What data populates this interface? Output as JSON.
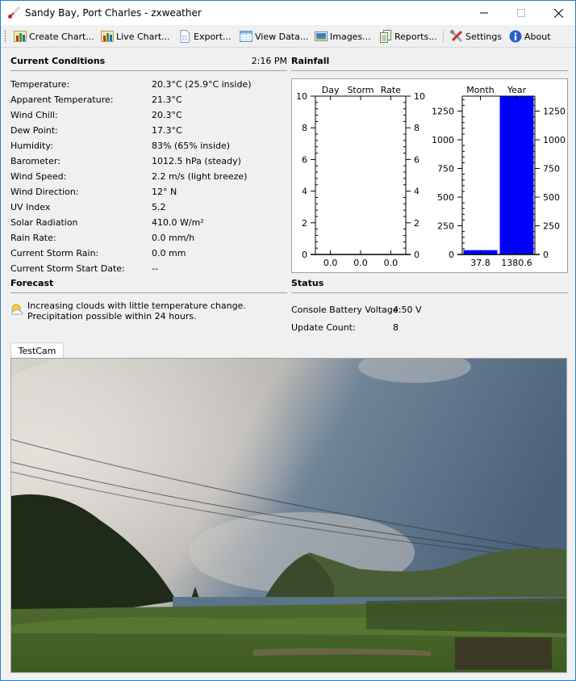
{
  "window": {
    "title": "Sandy Bay, Port Charles - zxweather",
    "icon": "thermometer-icon",
    "controls": {
      "minimize": "minimize-icon",
      "maximize": "maximize-icon",
      "close": "close-icon"
    }
  },
  "toolbar": {
    "items": [
      {
        "label": "Create Chart...",
        "icon": "bar-chart-icon"
      },
      {
        "label": "Live Chart...",
        "icon": "bar-chart-icon"
      },
      {
        "label": "Export...",
        "icon": "document-export-icon"
      },
      {
        "label": "View Data...",
        "icon": "table-icon"
      },
      {
        "label": "Images...",
        "icon": "image-icon"
      },
      {
        "label": "Reports...",
        "icon": "reports-icon"
      },
      {
        "label": "Settings",
        "icon": "tools-icon"
      },
      {
        "label": "About",
        "icon": "info-icon"
      }
    ]
  },
  "current_conditions": {
    "title": "Current Conditions",
    "time": "2:16 PM",
    "rows": [
      {
        "label": "Temperature:",
        "value": "20.3°C (25.9°C inside)"
      },
      {
        "label": "Apparent Temperature:",
        "value": "21.3°C"
      },
      {
        "label": "Wind Chill:",
        "value": "20.3°C"
      },
      {
        "label": "Dew Point:",
        "value": "17.3°C"
      },
      {
        "label": "Humidity:",
        "value": "83% (65% inside)"
      },
      {
        "label": "Barometer:",
        "value": "1012.5 hPa (steady)"
      },
      {
        "label": "Wind Speed:",
        "value": "2.2 m/s (light breeze)"
      },
      {
        "label": "Wind Direction:",
        "value": "12° N"
      },
      {
        "label": "UV Index",
        "value": "5.2"
      },
      {
        "label": "Solar Radiation",
        "value": "410.0 W/m²"
      },
      {
        "label": "Rain Rate:",
        "value": "0.0 mm/h"
      },
      {
        "label": "Current Storm Rain:",
        "value": "0.0 mm"
      },
      {
        "label": "Current Storm Start Date:",
        "value": "--"
      }
    ]
  },
  "rainfall": {
    "title": "Rainfall",
    "bar_color": "#0000ff"
  },
  "chart_data": [
    {
      "type": "bar",
      "title": "",
      "categories": [
        "Day",
        "Storm",
        "Rate"
      ],
      "values": [
        0.0,
        0.0,
        0.0
      ],
      "value_labels": [
        "0.0",
        "0.0",
        "0.0"
      ],
      "ylim": [
        0,
        10
      ],
      "yticks": [
        0,
        2,
        4,
        6,
        8,
        10
      ],
      "ytick_labels": [
        "0",
        "2",
        "4",
        "6",
        "8",
        "10"
      ],
      "category_axis": "top",
      "value_labels_axis": "bottom",
      "mirror_y_axis": true,
      "grid": false
    },
    {
      "type": "bar",
      "title": "",
      "categories": [
        "Month",
        "Year"
      ],
      "values": [
        37.8,
        1380.6
      ],
      "value_labels": [
        "37.8",
        "1380.6"
      ],
      "ylim": [
        0,
        1380.6
      ],
      "yticks": [
        0,
        250,
        500,
        750,
        1000,
        1250
      ],
      "ytick_labels": [
        "0",
        "250",
        "500",
        "750",
        "1000",
        "1250"
      ],
      "category_axis": "top",
      "value_labels_axis": "bottom",
      "mirror_y_axis": true,
      "grid": false
    }
  ],
  "forecast": {
    "title": "Forecast",
    "icon": "partly-cloudy-icon",
    "text": "Increasing clouds with little temperature change. Precipitation possible within 24 hours."
  },
  "status": {
    "title": "Status",
    "rows": [
      {
        "label": "Console Battery Voltage:",
        "value": "4.50 V"
      },
      {
        "label": "Update Count:",
        "value": "8"
      }
    ]
  },
  "camera": {
    "tabs": [
      {
        "label": "TestCam"
      }
    ]
  }
}
